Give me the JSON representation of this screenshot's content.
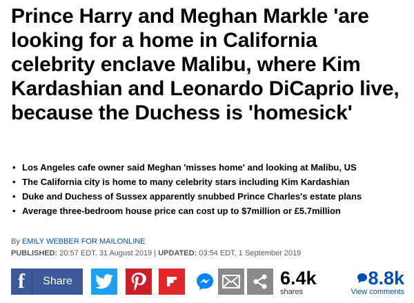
{
  "article": {
    "headline": "Prince Harry and Meghan Markle 'are looking for a home in California celebrity enclave Malibu, where Kim Kardashian and Leonardo DiCaprio live, because the Duchess is 'homesick'",
    "bullets": [
      "Los Angeles cafe owner said Meghan 'misses home' and looking at Malibu, US",
      "The California city is home to many celebrity stars including Kim Kardashian",
      "Duke and Duchess of Sussex apparently snubbed Prince Charles's estate plans",
      "Average three-bedroom house price can cost up to $7million or £5.7million"
    ],
    "bullet_symbol": "•",
    "byline": {
      "prefix": "By",
      "author": "EMILY WEBBER FOR MAILONLINE"
    },
    "dates": {
      "published_label": "PUBLISHED:",
      "published_value": "20:57 EDT, 31 August 2019",
      "separator": "|",
      "updated_label": "UPDATED:",
      "updated_value": "03:54 EDT, 1 September 2019"
    }
  },
  "share_bar": {
    "facebook_letter": "f",
    "facebook_label": "Share",
    "icons": [
      "facebook-icon",
      "twitter-icon",
      "pinterest-icon",
      "flipboard-icon",
      "messenger-icon",
      "email-icon",
      "share-icon"
    ],
    "shares_count": "6.4k",
    "shares_label": "shares",
    "comments_count": "8.8k",
    "comments_label": "View comments",
    "colors": {
      "facebook": "#3b5998",
      "twitter": "#1da1f2",
      "pinterest": "#cb2027",
      "flipboard": "#e12828",
      "messenger": "#0084ff",
      "grey": "#8a8a8a",
      "link_blue": "#004db3"
    }
  }
}
